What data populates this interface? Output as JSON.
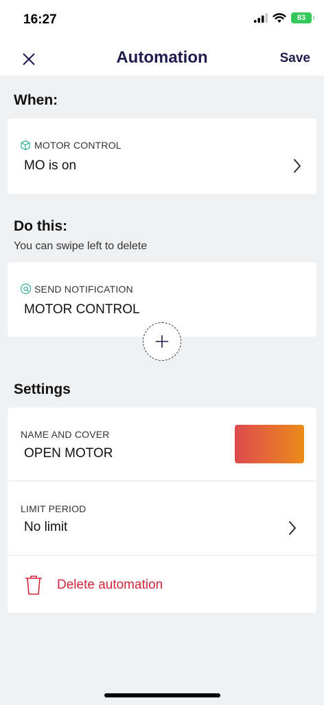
{
  "status_bar": {
    "time": "16:27",
    "battery": "83"
  },
  "nav": {
    "title": "Automation",
    "save_label": "Save"
  },
  "when": {
    "heading": "When:",
    "trigger": {
      "type_label": "MOTOR CONTROL",
      "value": "MO is on"
    }
  },
  "do_this": {
    "heading": "Do this:",
    "hint": "You can swipe left to delete",
    "action": {
      "type_label": "SEND NOTIFICATION",
      "value": "MOTOR CONTROL"
    }
  },
  "settings": {
    "heading": "Settings",
    "name_cover": {
      "label": "NAME AND COVER",
      "value": "OPEN MOTOR",
      "cover_gradient": [
        "#de4a4f",
        "#ea8b19"
      ]
    },
    "limit_period": {
      "label": "LIMIT PERIOD",
      "value": "No limit"
    },
    "delete_label": "Delete automation"
  },
  "colors": {
    "accent_teal": "#3bb3a0",
    "title_navy": "#1f1c4d",
    "danger": "#d3263a",
    "battery_green": "#34c759"
  }
}
